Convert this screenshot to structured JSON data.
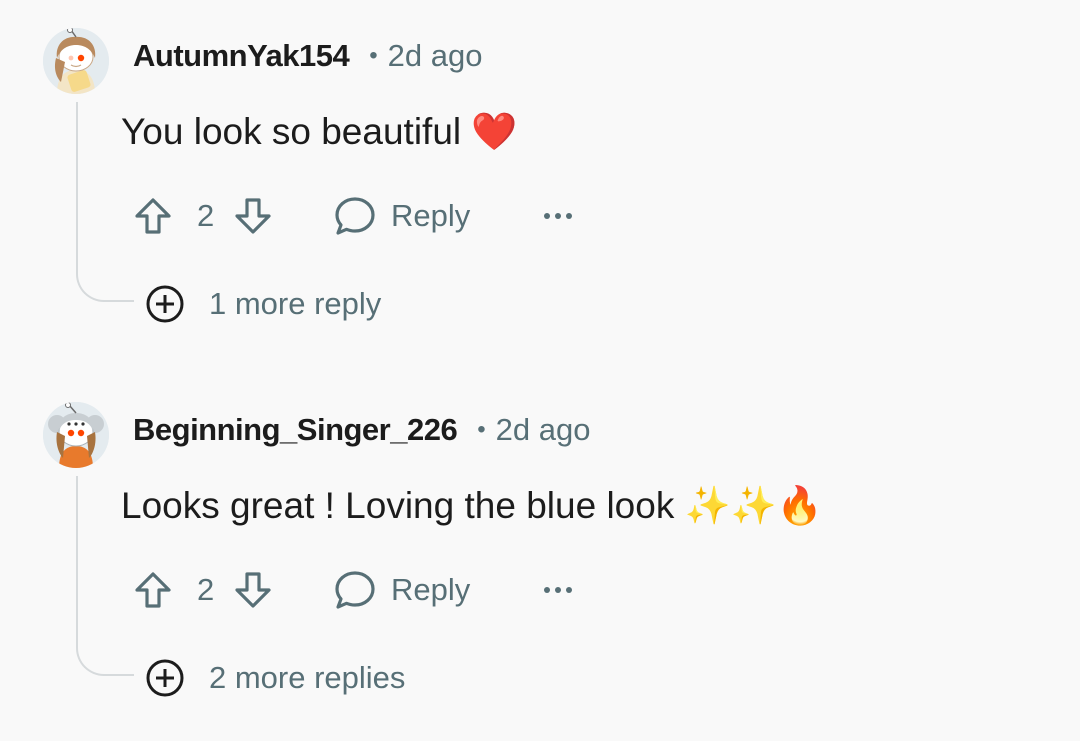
{
  "comments": [
    {
      "username": "AutumnYak154",
      "separator": "•",
      "time": "2d ago",
      "body": "You look so beautiful ❤️",
      "votes": "2",
      "reply_label": "Reply",
      "more_replies": "1 more reply",
      "avatar_icon": "snoo-avatar-icon"
    },
    {
      "username": "Beginning_Singer_226",
      "separator": "•",
      "time": "2d ago",
      "body": "Looks great ! Loving the blue look ✨✨🔥",
      "votes": "2",
      "reply_label": "Reply",
      "more_replies": "2 more replies",
      "avatar_icon": "snoo-avatar-icon"
    }
  ],
  "colors": {
    "background": "#f9f9f9",
    "secondary_text": "#576f76",
    "primary_text": "#1c1c1c",
    "thread_line": "#d6dadc",
    "snoo_eye": "#ff4500"
  }
}
